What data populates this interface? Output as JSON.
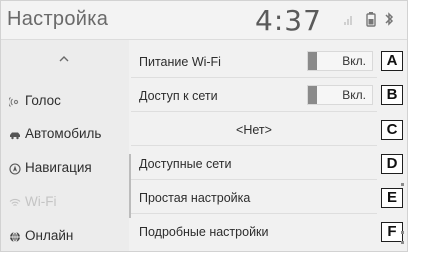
{
  "header": {
    "title": "Настройка",
    "clock": "4:37"
  },
  "status_icons": [
    "phone-signal-icon",
    "phone-battery-icon",
    "bluetooth-icon"
  ],
  "sidebar": {
    "up_icon": "chevron-up-icon",
    "items": [
      {
        "label": "Голос",
        "icon": "voice-icon",
        "active": false
      },
      {
        "label": "Автомобиль",
        "icon": "car-icon",
        "active": false
      },
      {
        "label": "Навигация",
        "icon": "navigation-icon",
        "active": false
      },
      {
        "label": "Wi-Fi",
        "icon": "wifi-icon",
        "active": true
      },
      {
        "label": "Онлайн",
        "icon": "globe-icon",
        "active": false
      }
    ]
  },
  "main": {
    "rows": [
      {
        "label": "Питание Wi-Fi",
        "toggle": "Вкл.",
        "callout": "A"
      },
      {
        "label": "Доступ к сети",
        "toggle": "Вкл.",
        "callout": "B"
      },
      {
        "label": "<Нет>",
        "callout": "C"
      },
      {
        "label": "Доступные сети",
        "callout": "D"
      },
      {
        "label": "Простая настройка",
        "callout": "E"
      },
      {
        "label": "Подробные настройки",
        "callout": "F"
      }
    ]
  },
  "colors": {
    "screen_bg": "#f1f1f1",
    "text": "#2d2d2d",
    "active_item": "#c4c4c4",
    "toggle_indicator": "#8a8a8a"
  }
}
